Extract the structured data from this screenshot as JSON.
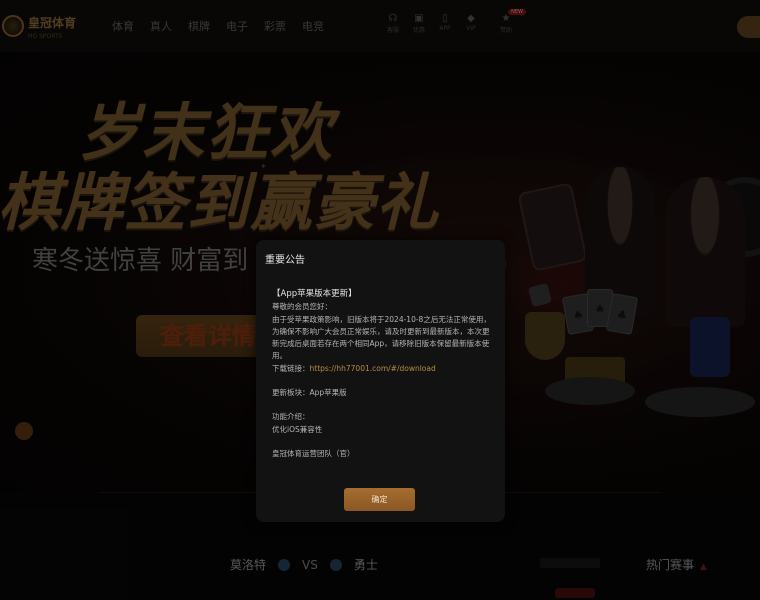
{
  "header": {
    "logo_text": "皇冠体育",
    "logo_sub": "HG SPORTS",
    "nav": [
      "体育",
      "真人",
      "棋牌",
      "电子",
      "彩票",
      "电竞"
    ],
    "tools": [
      {
        "icon": "headset-icon",
        "label": "客服"
      },
      {
        "icon": "gift-icon",
        "label": "优惠"
      },
      {
        "icon": "phone-icon",
        "label": "APP"
      },
      {
        "icon": "diamond-icon",
        "label": "VIP"
      },
      {
        "icon": "sponsor-icon",
        "label": "赞助",
        "badge": "NEW"
      }
    ]
  },
  "banner": {
    "headline1": "岁末狂欢",
    "headline2": "棋牌签到赢豪礼",
    "subline": "寒冬送惊喜 财富到",
    "cta": "查看详情"
  },
  "bottom": {
    "team_home": "莫洛特",
    "vs": "VS",
    "team_away": "勇士",
    "hot_label": "热门赛事"
  },
  "modal": {
    "title": "重要公告",
    "heading": "【App苹果版本更新】",
    "greeting": "尊敬的会员您好：",
    "paragraph": "由于受苹果政策影响，旧版本将于2024-10-8之后无法正常使用，为确保不影响广大会员正常娱乐，请及时更新到最新版本，本次更新完成后桌面若存在两个相同App，请移除旧版本保留最新版本使用。",
    "download_prefix": "下载链接：",
    "download_link": "https://hh77001.com/#/download",
    "module": "更新板块：App苹果版",
    "feature_title": "功能介绍：",
    "feature_item": "优化iOS兼容性",
    "signature": "皇冠体育运营团队（官）",
    "ok_button": "确定"
  }
}
